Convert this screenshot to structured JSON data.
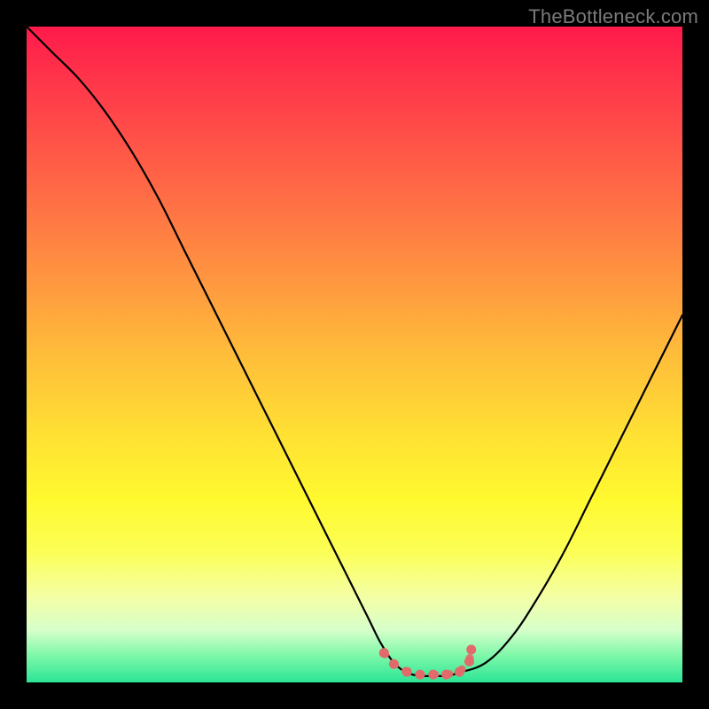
{
  "watermark": "TheBottleneck.com",
  "colors": {
    "curve_stroke": "#000000",
    "marker_fill": "#e26a6a",
    "marker_stroke": "#c95a5a"
  },
  "chart_data": {
    "type": "line",
    "title": "",
    "xlabel": "",
    "ylabel": "",
    "xlim": [
      0,
      100
    ],
    "ylim": [
      0,
      100
    ],
    "series": [
      {
        "name": "curve",
        "x": [
          0,
          4,
          8,
          12,
          16,
          20,
          24,
          28,
          32,
          36,
          40,
          44,
          48,
          52,
          54,
          56,
          58,
          60,
          62,
          64,
          66,
          70,
          74,
          78,
          82,
          86,
          90,
          94,
          98,
          100
        ],
        "y": [
          100,
          96,
          92,
          87,
          81,
          74,
          66,
          58,
          50,
          42,
          34,
          26,
          18,
          10,
          6,
          3,
          1.5,
          1,
          1,
          1,
          1.5,
          3,
          7,
          13,
          20,
          28,
          36,
          44,
          52,
          56
        ]
      }
    ],
    "markers": {
      "name": "highlight-dots",
      "x": [
        54.5,
        56,
        58,
        60,
        62,
        64,
        66,
        67.5,
        67.8
      ],
      "y": [
        4.5,
        2.8,
        1.6,
        1.2,
        1.2,
        1.2,
        1.6,
        3.2,
        5.0
      ]
    }
  }
}
